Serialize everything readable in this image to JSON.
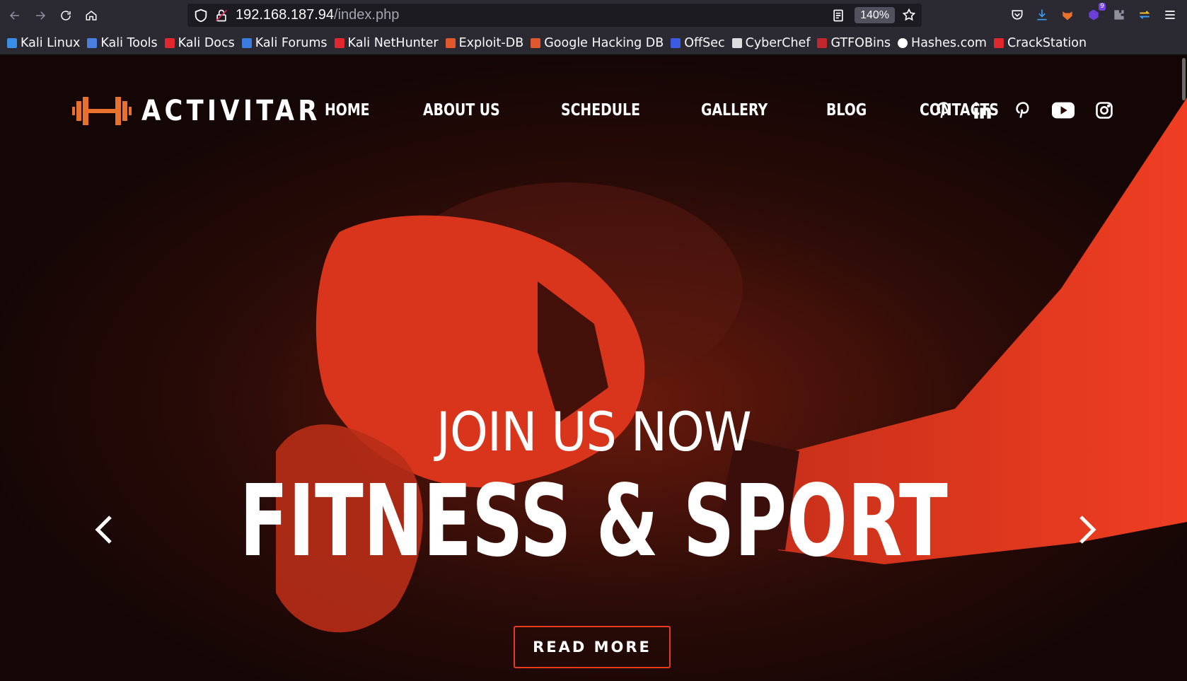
{
  "browser": {
    "url_host": "192.168.187.94",
    "url_path": "/index.php",
    "zoom": "140%",
    "extension_badge": "9"
  },
  "bookmarks": [
    {
      "label": "Kali Linux",
      "icon": "kali-dragon-icon",
      "color": "#3a8ee6"
    },
    {
      "label": "Kali Tools",
      "icon": "kali-tools-icon",
      "color": "#4a7fe0"
    },
    {
      "label": "Kali Docs",
      "icon": "kali-docs-icon",
      "color": "#e0282e"
    },
    {
      "label": "Kali Forums",
      "icon": "kali-forums-icon",
      "color": "#3c7be0"
    },
    {
      "label": "Kali NetHunter",
      "icon": "nethunter-icon",
      "color": "#e0282e"
    },
    {
      "label": "Exploit-DB",
      "icon": "exploit-db-icon",
      "color": "#e0582e"
    },
    {
      "label": "Google Hacking DB",
      "icon": "ghdb-icon",
      "color": "#e0582e"
    },
    {
      "label": "OffSec",
      "icon": "offsec-icon",
      "color": "#3c5be0"
    },
    {
      "label": "CyberChef",
      "icon": "cyberchef-icon",
      "color": "#dddddd"
    },
    {
      "label": "GTFOBins",
      "icon": "gtfobins-icon",
      "color": "#c0282e"
    },
    {
      "label": "Hashes.com",
      "icon": "hashes-icon",
      "color": "#ffffff"
    },
    {
      "label": "CrackStation",
      "icon": "crackstation-icon",
      "color": "#e0282e"
    }
  ],
  "site": {
    "logo": "ACTIVITAR",
    "brand_color": "#e63c1e",
    "menu": [
      "HOME",
      "ABOUT US",
      "SCHEDULE",
      "GALLERY",
      "BLOG",
      "CONTACTS"
    ],
    "social_icons": [
      "pinterest-icon",
      "linkedin-icon",
      "pinterest-icon",
      "youtube-icon",
      "instagram-icon"
    ]
  },
  "hero": {
    "kicker": "JOIN US NOW",
    "headline": "FITNESS & SPORT",
    "button": "READ MORE"
  }
}
